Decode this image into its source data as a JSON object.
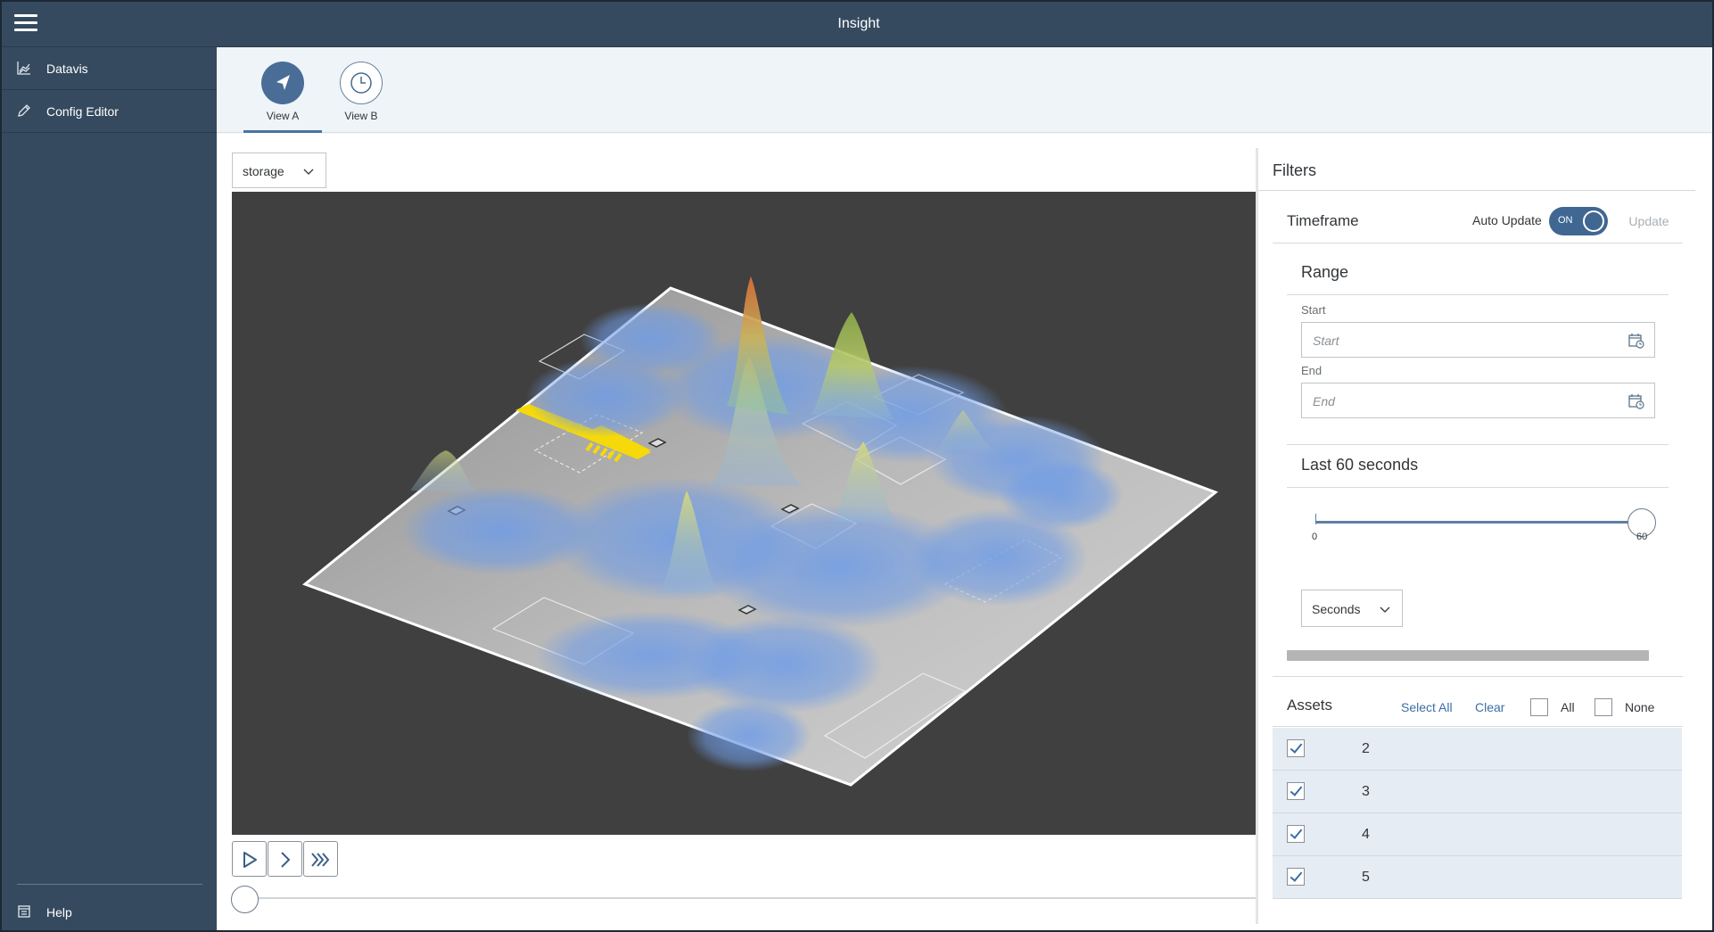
{
  "app": {
    "title": "Insight"
  },
  "sidebar": {
    "items": [
      {
        "label": "Datavis",
        "icon": "line-chart-icon"
      },
      {
        "label": "Config Editor",
        "icon": "pencil-icon"
      }
    ],
    "footer": {
      "label": "Help",
      "icon": "help-doc-icon"
    }
  },
  "views": [
    {
      "label": "View A",
      "icon": "navigation-arrow-icon",
      "active": true
    },
    {
      "label": "View B",
      "icon": "clock-icon",
      "active": false
    }
  ],
  "map": {
    "layer_select": {
      "value": "storage"
    },
    "playback": [
      "play-icon",
      "step-forward-icon",
      "fast-forward-icon"
    ]
  },
  "filters": {
    "title": "Filters",
    "timeframe": {
      "title": "Timeframe",
      "auto_update_label": "Auto Update",
      "toggle_text": "ON",
      "auto_update": true,
      "update_label": "Update"
    },
    "range": {
      "title": "Range",
      "start_label": "Start",
      "start_placeholder": "Start",
      "end_label": "End",
      "end_placeholder": "End"
    },
    "last": {
      "title": "Last 60 seconds",
      "min": "0",
      "max": "60",
      "value": 60,
      "unit": "Seconds"
    },
    "assets": {
      "title": "Assets",
      "select_all_label": "Select All",
      "clear_label": "Clear",
      "all_label": "All",
      "none_label": "None",
      "items": [
        {
          "label": "2",
          "checked": true
        },
        {
          "label": "3",
          "checked": true
        },
        {
          "label": "4",
          "checked": true
        },
        {
          "label": "5",
          "checked": true
        }
      ]
    }
  },
  "colors": {
    "shell": "#354a5f",
    "accent": "#496d96",
    "viz_background": "#404040",
    "heat_blue": "#6f9ce6",
    "heat_peak": "#e0723a",
    "zone_marker": "#f5d90a"
  }
}
